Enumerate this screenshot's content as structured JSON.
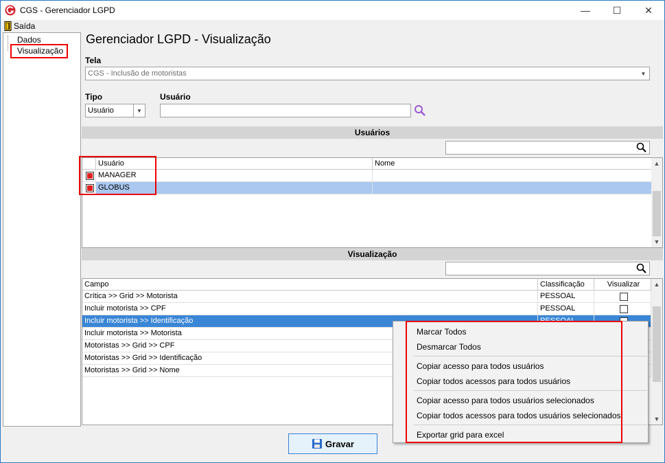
{
  "window": {
    "title": "CGS - Gerenciador LGPD",
    "min": "—",
    "max": "☐",
    "close": "✕"
  },
  "menubar": {
    "exit_label": "Saída"
  },
  "tree": {
    "items": [
      {
        "label": "Dados"
      },
      {
        "label": "Visualização"
      }
    ]
  },
  "header": {
    "title": "Gerenciador LGPD - Visualização"
  },
  "form": {
    "tela_label": "Tela",
    "tela_value": "CGS - Inclusão de motoristas",
    "tipo_label": "Tipo",
    "tipo_value": "Usuário",
    "usuario_label": "Usuário",
    "usuario_value": ""
  },
  "users_section": {
    "title": "Usuários",
    "columns": [
      "Usuário",
      "Nome"
    ],
    "rows": [
      {
        "checked": true,
        "usuario": "MANAGER",
        "nome": ""
      },
      {
        "checked": true,
        "usuario": "GLOBUS",
        "nome": ""
      }
    ]
  },
  "view_section": {
    "title": "Visualização",
    "columns": [
      "Campo",
      "Classificação",
      "Visualizar"
    ],
    "rows": [
      {
        "campo": "Crítica >> Grid >> Motorista",
        "classificacao": "PESSOAL",
        "visualizar": false
      },
      {
        "campo": "Incluir motorista >> CPF",
        "classificacao": "PESSOAL",
        "visualizar": false
      },
      {
        "campo": "Incluir motorista >> Identificação",
        "classificacao": "PESSOAL",
        "visualizar": false
      },
      {
        "campo": "Incluir motorista >> Motorista",
        "classificacao": "",
        "visualizar": false
      },
      {
        "campo": "Motoristas >> Grid >> CPF",
        "classificacao": "",
        "visualizar": false
      },
      {
        "campo": "Motoristas >> Grid >> Identificação",
        "classificacao": "",
        "visualizar": false
      },
      {
        "campo": "Motoristas >> Grid >> Nome",
        "classificacao": "",
        "visualizar": false
      }
    ]
  },
  "save_button": {
    "label": "Gravar"
  },
  "context_menu": {
    "items": [
      "Marcar Todos",
      "Desmarcar Todos",
      "Copiar acesso para todos usuários",
      "Copiar todos acessos para todos usuários",
      "Copiar acesso para todos usuários selecionados",
      "Copiar todos acessos para todos usuários selecionados",
      "Exportar grid para excel"
    ]
  },
  "colors": {
    "highlight": "#e00000",
    "selection": "#3a86d6",
    "accent": "#9b59d0"
  }
}
